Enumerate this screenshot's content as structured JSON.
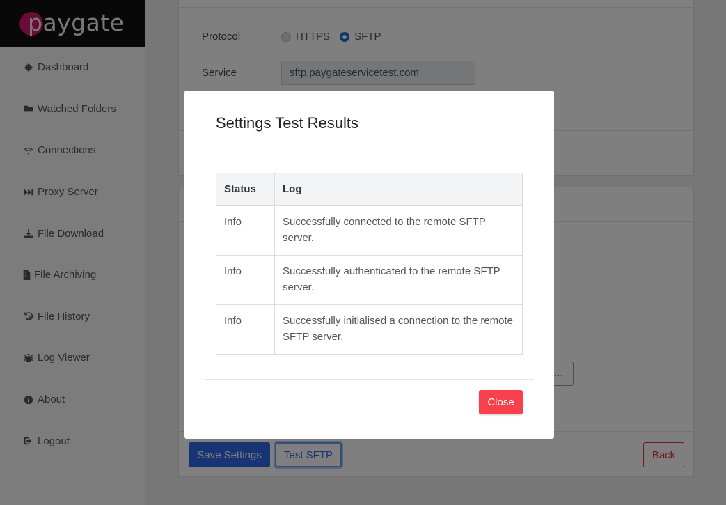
{
  "app": {
    "logo_text": "paygate"
  },
  "sidebar": {
    "items": [
      {
        "label": "Dashboard",
        "icon": "gear-icon"
      },
      {
        "label": "Watched Folders",
        "icon": "folder-icon"
      },
      {
        "label": "Connections",
        "icon": "wifi-icon"
      },
      {
        "label": "Proxy Server",
        "icon": "fast-forward-icon"
      },
      {
        "label": "File Download",
        "icon": "download-icon"
      },
      {
        "label": "File Archiving",
        "icon": "file-archive-icon"
      },
      {
        "label": "File History",
        "icon": "history-icon"
      },
      {
        "label": "Log Viewer",
        "icon": "bug-icon"
      },
      {
        "label": "About",
        "icon": "info-icon"
      },
      {
        "label": "Logout",
        "icon": "logout-icon"
      }
    ]
  },
  "form": {
    "protocol_label": "Protocol",
    "protocol_options": [
      {
        "label": "HTTPS",
        "selected": false
      },
      {
        "label": "SFTP",
        "selected": true
      }
    ],
    "service_label": "Service",
    "service_value": "sftp.paygateservicetest.com",
    "browse_label": "..."
  },
  "actions": {
    "save_label": "Save Settings",
    "test_label": "Test SFTP",
    "back_label": "Back"
  },
  "modal": {
    "title": "Settings Test Results",
    "columns": [
      "Status",
      "Log"
    ],
    "rows": [
      {
        "status": "Info",
        "log": "Successfully connected to the remote SFTP server."
      },
      {
        "status": "Info",
        "log": "Successfully authenticated to the remote SFTP server."
      },
      {
        "status": "Info",
        "log": "Successfully initialised a connection to the remote SFTP server."
      }
    ],
    "close_label": "Close"
  },
  "colors": {
    "brand": "#d6176e",
    "primary": "#2e6be8",
    "danger": "#f7424e"
  }
}
